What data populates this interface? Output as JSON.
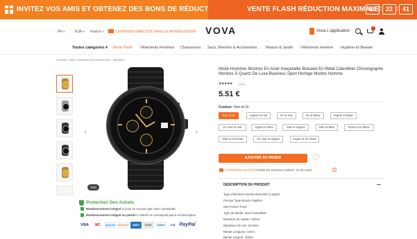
{
  "promo": {
    "left_text": "INVITEZ VOS AMIS ET OBTENEZ DES BONS DE RÉDUCTION",
    "right_text": "VENTE FLASH RÉDUCTION MAXIMALE",
    "timer": [
      "09",
      "22",
      "41"
    ],
    "colors": {
      "orange": "#f4801f",
      "orange_dark": "#ef6420"
    }
  },
  "header": {
    "language": "FR",
    "currency": "EUR",
    "country": "France",
    "shipping_notice": "LIVRAISON GRATUITE DANS LE MONDE ENTIER",
    "logo": "VOVA",
    "app_label": "Vova L'application",
    "cart_count": "1",
    "icons": [
      "search-icon",
      "cart-icon",
      "user-icon",
      "truck-icon",
      "phone-icon"
    ]
  },
  "nav": {
    "items": [
      "Toutes catégories ▾",
      "Vente Flash",
      "Vêtements Femmes",
      "Chaussures",
      "Sacs, Montres & Accessoires",
      "Maison & Jardin",
      "Vêtements Homme",
      "Hygiène Et Beauté"
    ]
  },
  "breadcrumb": "Accueil › Sacs, Montres Et Accessoires › Montres",
  "gallery": {
    "counter": "4/20"
  },
  "protection": {
    "title": "Protection Des Achats",
    "line1_bold": "Remboursement intégral",
    "line1_rest": " si vous ne recevez pas votre commande.",
    "line2_bold": "Remboursement intégral ou partiel",
    "line2_rest": " si l'article ne correspond pas à sa description",
    "payments": [
      "VISA",
      "MC",
      "MAESTRO",
      "DISCOVER",
      "AMEX",
      "BANK",
      "DINERS",
      "JCB",
      "PayPal"
    ]
  },
  "product": {
    "title": "Mode Hommes Montres En Acier Inoxydable Bracelet En Métal Calendrier Chronographe Montres À Quartz De Luxe Business Sport Horloge Montre Homme",
    "stars": "★★★★★",
    "rating_count": "(591)",
    "price": "5.51 €",
    "color_label": "Couleur:",
    "color_value": "Noir et Or",
    "options": [
      "Noir et Or",
      "Argent et noir",
      "Or et noir",
      "Or et blanc",
      "Argent et blanc",
      "Or rose et noir",
      "Argent et bleu",
      "Noir et argent",
      "Noir et Bleu",
      "Rose et et blanc",
      "Noir et Or Rose",
      "Or rose et argent",
      "Argent & Or Rose"
    ],
    "selected_option": "Noir et Or",
    "add_to_cart": "AJOUTER AU PANIER",
    "shipping_free": "LIVRAISON GRATUITE",
    "shipping_rest": "Délai De Livraison Estimé: 15-30 Jours",
    "description_heading": "DESCRIPTION DU PRODUIT",
    "description_lines": [
      "Type d'élément montres-bracelets à quartz",
      "Fermoir Type Boucle Papillon",
      "Etui Forme: Rond",
      "Type de bande: acier inoxydable",
      "Diamètre du cadran: 42mm",
      "Épaisseur de cas: 10.5mm",
      "Bande Longueur: 24cm",
      "Bande Largeur: 20mm"
    ],
    "accent_color": "#f26d21"
  }
}
